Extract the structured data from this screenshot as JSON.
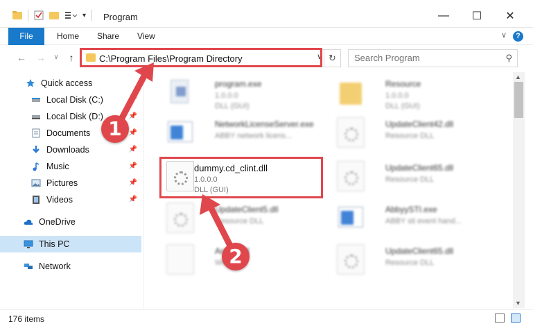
{
  "window": {
    "title": "Program",
    "minimize_glyph": "—",
    "maximize_glyph": "☐",
    "close_glyph": "✕"
  },
  "ribbon": {
    "file_label": "File",
    "home_label": "Home",
    "share_label": "Share",
    "view_label": "View",
    "help_glyph": "?",
    "collapse_glyph": "∨",
    "accent_color": "#1979ca"
  },
  "navigation": {
    "back_glyph": "←",
    "forward_glyph": "→",
    "recent_glyph": "∨",
    "up_glyph": "↑"
  },
  "address": {
    "path": "C:\\Program Files\\Program Directory",
    "dropdown_glyph": "∨",
    "refresh_glyph": "↻"
  },
  "search": {
    "placeholder": "Search Program",
    "icon": "search-icon"
  },
  "sidebar": {
    "items": [
      {
        "label": "Quick access",
        "icon": "star-icon"
      },
      {
        "label": "Local Disk (C:)",
        "icon": "drive-icon",
        "pinned": true
      },
      {
        "label": "Local Disk (D:)",
        "icon": "drive-icon",
        "pinned": true
      },
      {
        "label": "Documents",
        "icon": "documents-icon",
        "pinned": true
      },
      {
        "label": "Downloads",
        "icon": "download-icon",
        "pinned": true
      },
      {
        "label": "Music",
        "icon": "music-icon",
        "pinned": true
      },
      {
        "label": "Pictures",
        "icon": "pictures-icon",
        "pinned": true
      },
      {
        "label": "Videos",
        "icon": "videos-icon",
        "pinned": true
      },
      {
        "label": "OneDrive",
        "icon": "cloud-icon"
      },
      {
        "label": "This PC",
        "icon": "computer-icon",
        "selected": true
      },
      {
        "label": "Network",
        "icon": "network-icon"
      }
    ]
  },
  "files": [
    {
      "name": "program.exe",
      "line2": "1.0.0.0",
      "line3": "DLL (GUI)",
      "icon": "exe-icon",
      "blurred": true
    },
    {
      "name": "Resource",
      "line2": "1.0.0.0",
      "line3": "DLL (GUI)",
      "icon": "folder-icon",
      "blurred": true
    },
    {
      "name": "NetworkLicenseServer.exe",
      "line2": "ABBY network licens...",
      "line3": "",
      "icon": "window-icon",
      "blurred": true
    },
    {
      "name": "UpdateClient42.dll",
      "line2": "Resource DLL",
      "line3": "",
      "icon": "dll-icon",
      "blurred": true
    },
    {
      "name": "dummy.cd_clint.dll",
      "line2": "1.0.0.0",
      "line3": "DLL (GUI)",
      "icon": "dll-gear-icon",
      "blurred": false,
      "highlighted": true
    },
    {
      "name": "UpdateClient65.dll",
      "line2": "Resource DLL",
      "line3": "",
      "icon": "dll-icon",
      "blurred": true
    },
    {
      "name": "UpdateClient5.dll",
      "line2": "Resource DLL",
      "line3": "",
      "icon": "dll-icon",
      "blurred": true
    },
    {
      "name": "AbbyySTI.exe",
      "line2": "ABBY sti event hand...",
      "line3": "",
      "icon": "window-icon",
      "blurred": true
    },
    {
      "name": "Arabic.dll",
      "line2": "WIID File",
      "line3": "",
      "icon": "dll-icon",
      "blurred": true
    },
    {
      "name": "UpdateClient65.dll",
      "line2": "Resource DLL",
      "line3": "",
      "icon": "dll-icon",
      "blurred": true
    }
  ],
  "status": {
    "item_count": "176 items"
  },
  "annotations": {
    "step1": "1",
    "step2": "2",
    "color": "#e0474c"
  }
}
